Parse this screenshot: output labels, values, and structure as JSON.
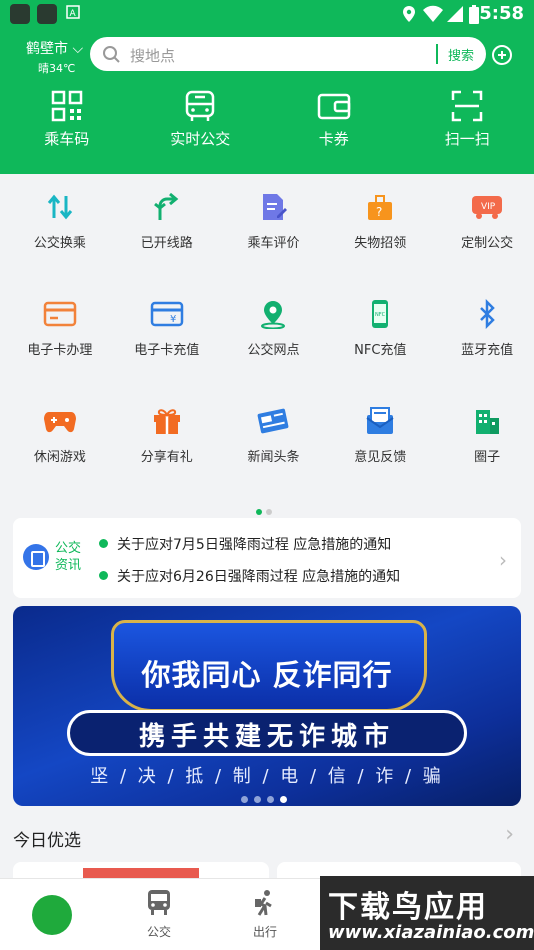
{
  "status": {
    "time": "5:58"
  },
  "header": {
    "city": "鹤壁市",
    "weather": "晴34℃",
    "search_placeholder": "搜地点",
    "search_button": "搜索",
    "nav": [
      {
        "label": "乘车码",
        "icon": "qr-code-icon"
      },
      {
        "label": "实时公交",
        "icon": "bus-icon"
      },
      {
        "label": "卡券",
        "icon": "wallet-icon"
      },
      {
        "label": "扫一扫",
        "icon": "scan-icon"
      }
    ]
  },
  "services": [
    [
      {
        "label": "公交换乘",
        "icon": "transfer-icon"
      },
      {
        "label": "已开线路",
        "icon": "route-icon"
      },
      {
        "label": "乘车评价",
        "icon": "review-icon"
      },
      {
        "label": "失物招领",
        "icon": "lost-found-icon"
      },
      {
        "label": "定制公交",
        "icon": "vip-bus-icon"
      }
    ],
    [
      {
        "label": "电子卡办理",
        "icon": "card-apply-icon"
      },
      {
        "label": "电子卡充值",
        "icon": "card-topup-icon"
      },
      {
        "label": "公交网点",
        "icon": "location-icon"
      },
      {
        "label": "NFC充值",
        "icon": "nfc-icon"
      },
      {
        "label": "蓝牙充值",
        "icon": "bluetooth-icon"
      }
    ],
    [
      {
        "label": "休闲游戏",
        "icon": "gamepad-icon"
      },
      {
        "label": "分享有礼",
        "icon": "gift-icon"
      },
      {
        "label": "新闻头条",
        "icon": "news-icon"
      },
      {
        "label": "意见反馈",
        "icon": "feedback-icon"
      },
      {
        "label": "圈子",
        "icon": "community-icon"
      }
    ]
  ],
  "news": {
    "label_line1": "公交",
    "label_line2": "资讯",
    "items": [
      "关于应对7月5日强降雨过程 应急措施的通知",
      "关于应对6月26日强降雨过程 应急措施的通知"
    ]
  },
  "banner": {
    "title": "你我同心 反诈同行",
    "subtitle": "携手共建无诈城市",
    "slogan": "坚 / 决 / 抵 / 制 / 电 / 信 / 诈 / 骗"
  },
  "today": {
    "title": "今日优选"
  },
  "tabs": [
    {
      "label": "",
      "icon": "home-logo-icon"
    },
    {
      "label": "公交",
      "icon": "bus-icon"
    },
    {
      "label": "出行",
      "icon": "walk-icon"
    }
  ],
  "watermark": {
    "line1": "下载鸟应用",
    "line2": "www.xiazainiao.com"
  },
  "colors": {
    "brand": "#0fb85a",
    "banner": "#1447c4"
  }
}
